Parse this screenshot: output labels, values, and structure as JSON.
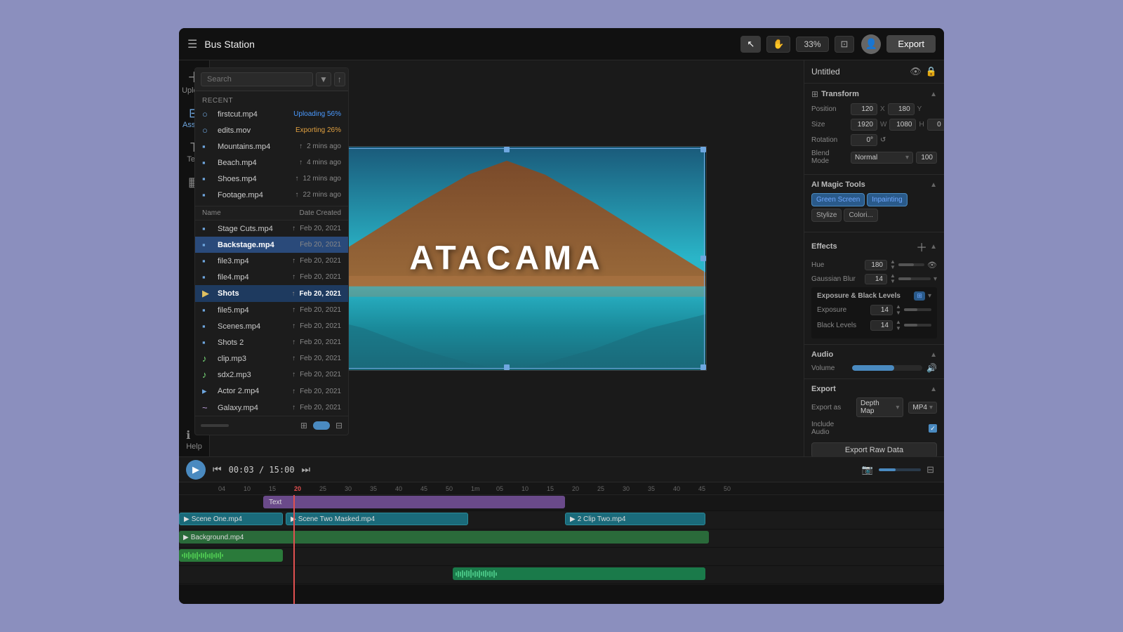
{
  "header": {
    "title": "Bus Station",
    "export_label": "Export",
    "zoom": "33%"
  },
  "file_browser": {
    "search_placeholder": "Search",
    "recent_label": "Recent",
    "col_name": "Name",
    "col_date": "Date Created",
    "files": [
      {
        "name": "firstcut.mp4",
        "type": "video",
        "status": "Uploading 56%",
        "status_type": "upload",
        "date": ""
      },
      {
        "name": "edits.mov",
        "type": "video",
        "status": "Exporting 26%",
        "status_type": "export",
        "date": ""
      },
      {
        "name": "Mountains.mp4",
        "type": "video",
        "status": "",
        "date": "2 mins ago"
      },
      {
        "name": "Beach.mp4",
        "type": "video",
        "status": "",
        "date": "4 mins ago"
      },
      {
        "name": "Shoes.mp4",
        "type": "video",
        "status": "",
        "date": "12 mins ago"
      },
      {
        "name": "Footage.mp4",
        "type": "video",
        "status": "",
        "date": "22 mins ago"
      },
      {
        "name": "Stage Cuts.mp4",
        "type": "video",
        "status": "",
        "date": "Feb 20, 2021"
      },
      {
        "name": "Backstage.mp4",
        "type": "video",
        "status": "",
        "date": "Feb 20, 2021",
        "bold": true
      },
      {
        "name": "file3.mp4",
        "type": "video",
        "status": "",
        "date": "Feb 20, 2021"
      },
      {
        "name": "file4.mp4",
        "type": "video",
        "status": "",
        "date": "Feb 20, 2021"
      },
      {
        "name": "Shots",
        "type": "folder",
        "status": "",
        "date": "Feb 20, 2021",
        "bold": true,
        "selected": true
      },
      {
        "name": "file5.mp4",
        "type": "video",
        "status": "",
        "date": "Feb 20, 2021"
      },
      {
        "name": "Scenes.mp4",
        "type": "video",
        "status": "",
        "date": "Feb 20, 2021"
      },
      {
        "name": "Shots 2",
        "type": "video",
        "status": "",
        "date": "Feb 20, 2021"
      },
      {
        "name": "clip.mp3",
        "type": "audio",
        "status": "",
        "date": "Feb 20, 2021"
      },
      {
        "name": "sdx2.mp3",
        "type": "audio",
        "status": "",
        "date": "Feb 20, 2021"
      },
      {
        "name": "Actor 2.mp4",
        "type": "video",
        "status": "",
        "date": "Feb 20, 2021"
      },
      {
        "name": "Galaxy.mp4",
        "type": "video",
        "status": "",
        "date": "Feb 20, 2021"
      }
    ]
  },
  "canvas": {
    "title": "ATACAMA"
  },
  "right_panel": {
    "title": "Untitled",
    "sections": {
      "transform": {
        "label": "Transform",
        "position_x": "120",
        "position_y": "180",
        "size_w": "1920",
        "size_h": "1080",
        "size_z": "0",
        "rotation": "0°",
        "blend_mode": "Normal",
        "blend_opacity": "100"
      },
      "ai_magic": {
        "label": "AI Magic Tools",
        "tabs": [
          "Green Screen",
          "Inpainting",
          "Stylize",
          "Colori..."
        ]
      },
      "effects": {
        "label": "Effects",
        "hue_value": "180",
        "gaussian_blur_value": "14",
        "exposure_label": "Exposure & Black Levels",
        "exposure_value": "14",
        "black_levels_value": "14"
      },
      "audio": {
        "label": "Audio",
        "volume_label": "Volume"
      },
      "export": {
        "label": "Export",
        "export_as_label": "Export as",
        "export_type": "Depth Map",
        "export_format": "MP4",
        "include_audio_label": "Include Audio",
        "raw_data_btn": "Export Raw Data"
      }
    }
  },
  "timeline": {
    "time_current": "00:03",
    "time_total": "15:00",
    "tracks": {
      "text_track": {
        "label": "Text",
        "clip_label": "Text"
      },
      "scene_track": {
        "clip1": "Scene One.mp4",
        "clip2": "Scene Two Masked.mp4",
        "clip3": "2 Clip Two.mp4"
      },
      "bg_track": {
        "clip1": "Background.mp4"
      },
      "audio_track1": {},
      "audio_track2": {}
    },
    "ruler_marks": [
      "04",
      "10",
      "15",
      "20",
      "25",
      "30",
      "35",
      "40",
      "45",
      "50",
      "1m",
      "05",
      "10",
      "15",
      "20",
      "25",
      "30",
      "35",
      "40",
      "45",
      "50"
    ]
  }
}
